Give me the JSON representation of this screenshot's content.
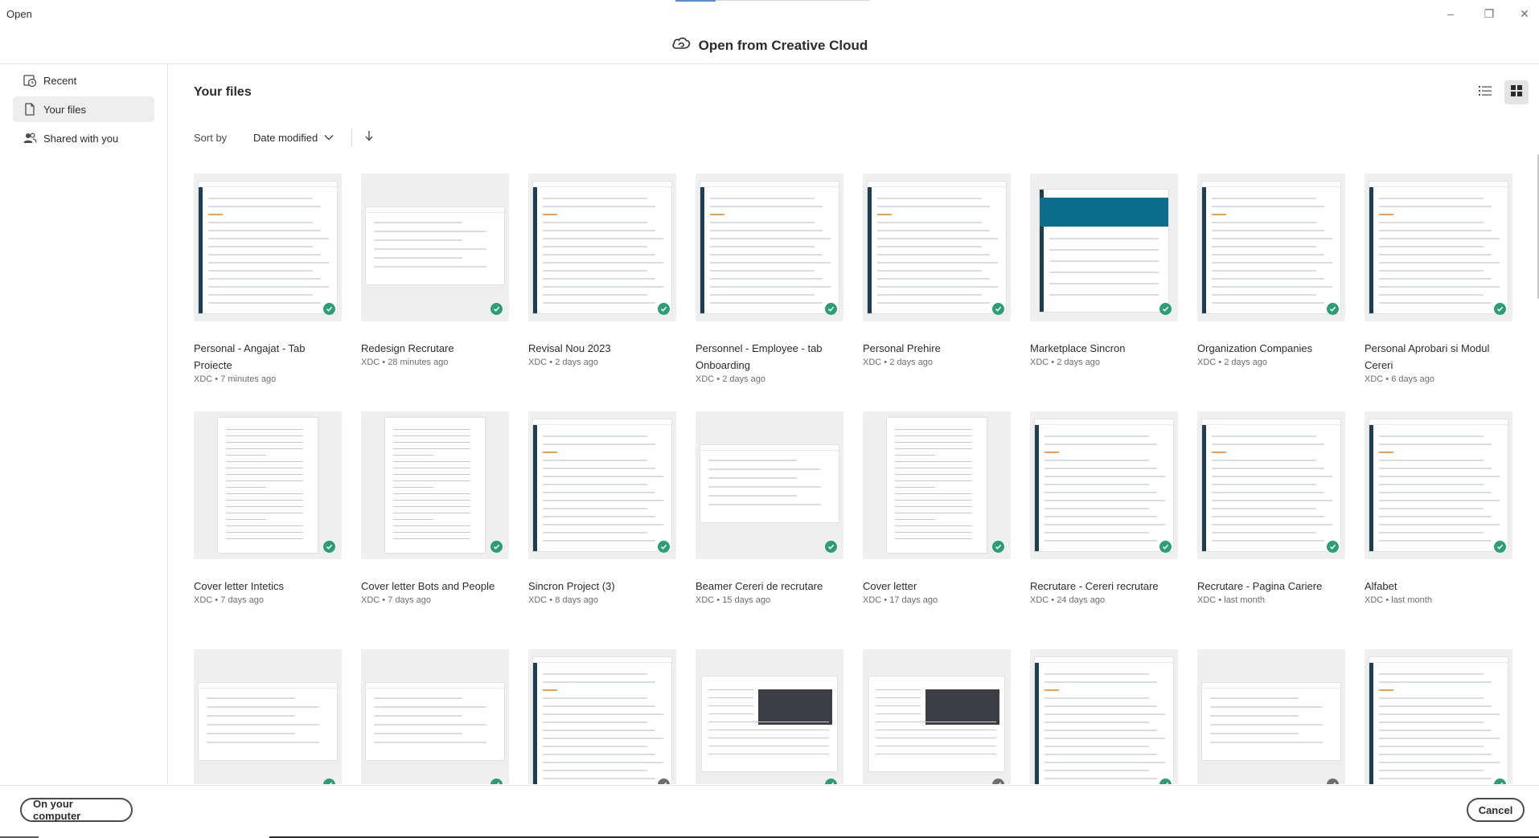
{
  "window": {
    "title": "Open",
    "minimize_glyph": "–",
    "restore_glyph": "❐",
    "close_glyph": "✕"
  },
  "header": {
    "title": "Open from Creative Cloud",
    "icon": "creative-cloud-icon"
  },
  "sidebar": {
    "items": [
      {
        "label": "Recent",
        "icon": "recent-icon",
        "active": false
      },
      {
        "label": "Your files",
        "icon": "document-icon",
        "active": true
      },
      {
        "label": "Shared with you",
        "icon": "people-icon",
        "active": false
      }
    ]
  },
  "main": {
    "title": "Your files",
    "sort_label": "Sort by",
    "sort_value": "Date modified",
    "sort_direction": "descending",
    "view_mode": "grid"
  },
  "files": [
    {
      "name": "Personal - Angajat - Tab Proiecte",
      "meta": "XDC • 7 minutes ago",
      "status": "synced",
      "preview": "app"
    },
    {
      "name": "Redesign Recrutare",
      "meta": "XDC • 28 minutes ago",
      "status": "synced",
      "preview": "wide"
    },
    {
      "name": "Revisal Nou 2023",
      "meta": "XDC • 2 days ago",
      "status": "synced",
      "preview": "app"
    },
    {
      "name": "Personnel - Employee - tab Onboarding",
      "meta": "XDC • 2 days ago",
      "status": "synced",
      "preview": "app"
    },
    {
      "name": "Personal Prehire",
      "meta": "XDC • 2 days ago",
      "status": "synced",
      "preview": "app"
    },
    {
      "name": "Marketplace Sincron",
      "meta": "XDC • 2 days ago",
      "status": "synced",
      "preview": "hero"
    },
    {
      "name": "Organization Companies",
      "meta": "XDC • 2 days ago",
      "status": "synced",
      "preview": "app"
    },
    {
      "name": "Personal Aprobari si Modul Cereri",
      "meta": "XDC • 6 days ago",
      "status": "synced",
      "preview": "app"
    },
    {
      "name": "Cover letter Intetics",
      "meta": "XDC • 7 days ago",
      "status": "synced",
      "preview": "doc"
    },
    {
      "name": "Cover letter Bots and People",
      "meta": "XDC • 7 days ago",
      "status": "synced",
      "preview": "doc"
    },
    {
      "name": "Sincron Project (3)",
      "meta": "XDC • 8 days ago",
      "status": "synced",
      "preview": "app"
    },
    {
      "name": "Beamer Cereri de recrutare",
      "meta": "XDC • 15 days ago",
      "status": "synced",
      "preview": "wide"
    },
    {
      "name": "Cover letter",
      "meta": "XDC • 17 days ago",
      "status": "synced",
      "preview": "doc"
    },
    {
      "name": "Recrutare - Cereri recrutare",
      "meta": "XDC • 24 days ago",
      "status": "synced",
      "preview": "app"
    },
    {
      "name": "Recrutare - Pagina Cariere",
      "meta": "XDC • last month",
      "status": "synced",
      "preview": "app"
    },
    {
      "name": "Alfabet",
      "meta": "XDC • last month",
      "status": "synced",
      "preview": "app"
    },
    {
      "name": "",
      "meta": "",
      "status": "synced",
      "preview": "wide"
    },
    {
      "name": "",
      "meta": "",
      "status": "synced",
      "preview": "wide"
    },
    {
      "name": "",
      "meta": "",
      "status": "cloud",
      "preview": "app"
    },
    {
      "name": "",
      "meta": "",
      "status": "synced",
      "preview": "blog"
    },
    {
      "name": "",
      "meta": "",
      "status": "cloud",
      "preview": "blog"
    },
    {
      "name": "",
      "meta": "",
      "status": "synced",
      "preview": "app"
    },
    {
      "name": "",
      "meta": "",
      "status": "cloud",
      "preview": "wide"
    },
    {
      "name": "",
      "meta": "",
      "status": "synced",
      "preview": "app"
    }
  ],
  "footer": {
    "local_button": "On your computer",
    "cancel_button": "Cancel"
  },
  "colors": {
    "synced": "#2d9d78",
    "cloud": "#6e6e6e",
    "app_sidebar": "#1f3f4f",
    "hero": "#0d6e8c"
  }
}
